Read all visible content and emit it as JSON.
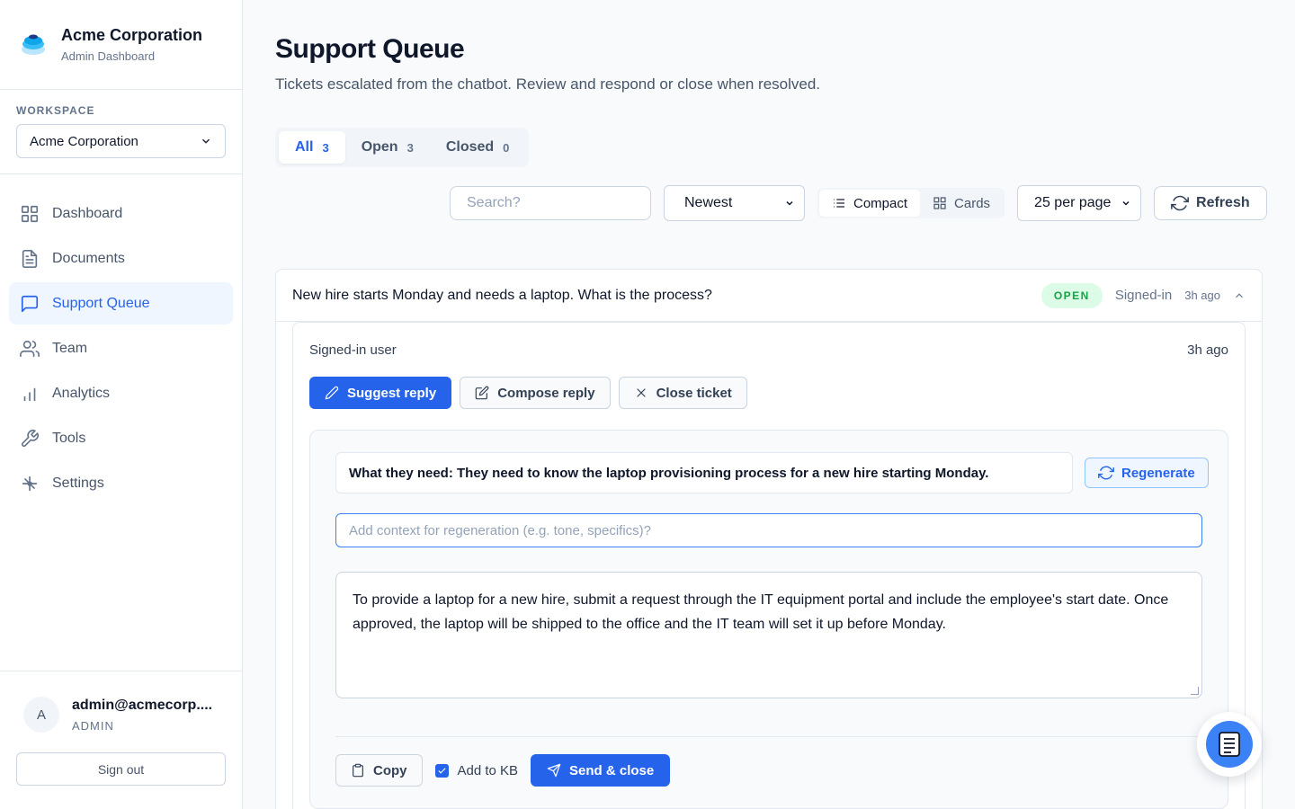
{
  "brand": {
    "name": "Acme Corporation",
    "subtitle": "Admin Dashboard"
  },
  "workspace": {
    "label": "WORKSPACE",
    "selected": "Acme Corporation"
  },
  "nav": {
    "items": [
      {
        "label": "Dashboard",
        "icon": "grid-icon"
      },
      {
        "label": "Documents",
        "icon": "document-icon"
      },
      {
        "label": "Support Queue",
        "icon": "chat-icon",
        "active": true
      },
      {
        "label": "Team",
        "icon": "users-icon"
      },
      {
        "label": "Analytics",
        "icon": "bar-chart-icon"
      },
      {
        "label": "Tools",
        "icon": "wrench-icon"
      },
      {
        "label": "Settings",
        "icon": "settings-icon"
      }
    ]
  },
  "user": {
    "initial": "A",
    "email": "admin@acmecorp....",
    "role": "ADMIN",
    "signout_label": "Sign out"
  },
  "page": {
    "title": "Support Queue",
    "subtitle": "Tickets escalated from the chatbot. Review and respond or close when resolved."
  },
  "tabs": [
    {
      "label": "All",
      "count": "3",
      "active": true
    },
    {
      "label": "Open",
      "count": "3"
    },
    {
      "label": "Closed",
      "count": "0"
    }
  ],
  "toolbar": {
    "search_placeholder": "Search?",
    "sort_value": "Newest",
    "view_compact": "Compact",
    "view_cards": "Cards",
    "view_active": "Compact",
    "per_page": "25 per page",
    "refresh_label": "Refresh"
  },
  "ticket": {
    "question": "New hire starts Monday and needs a laptop. What is the process?",
    "status": "OPEN",
    "source": "Signed-in",
    "time": "3h ago",
    "detail": {
      "user_label": "Signed-in user",
      "time": "3h ago",
      "suggest_label": "Suggest reply",
      "compose_label": "Compose reply",
      "close_label": "Close ticket",
      "need_text": "What they need: They need to know the laptop provisioning process for a new hire starting Monday.",
      "regenerate_label": "Regenerate",
      "context_placeholder": "Add context for regeneration (e.g. tone, specifics)?",
      "reply_text": "To provide a laptop for a new hire, submit a request through the IT equipment portal and include the employee's start date. Once approved, the laptop will be shipped to the office and the IT team will set it up before Monday.",
      "copy_label": "Copy",
      "add_kb_label": "Add to KB",
      "add_kb_checked": true,
      "send_label": "Send & close"
    }
  },
  "colors": {
    "accent": "#2563eb",
    "open_badge_bg": "#dcfce7",
    "open_badge_text": "#16a34a"
  }
}
